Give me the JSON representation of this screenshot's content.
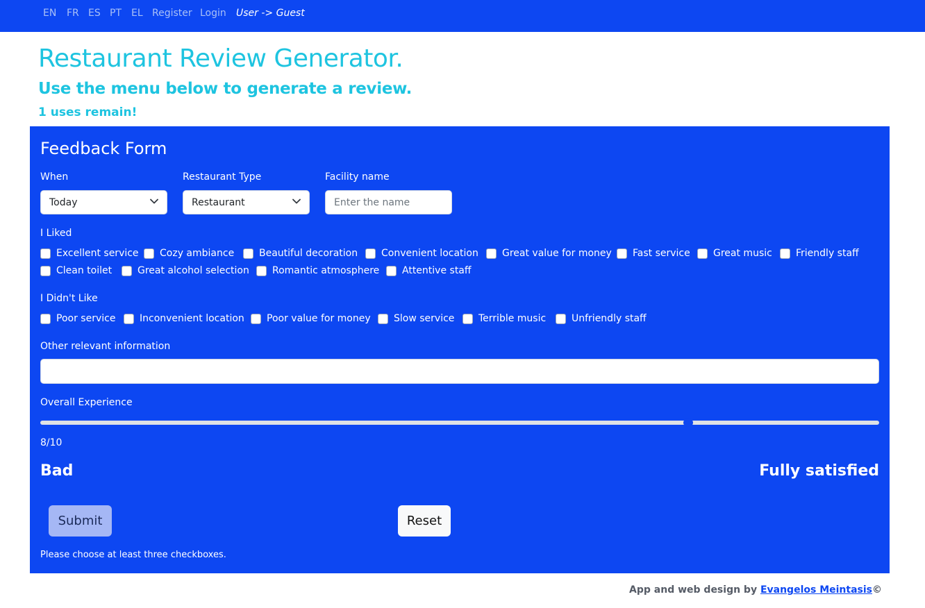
{
  "nav": {
    "items": [
      "EN",
      "FR",
      "ES",
      "PT",
      "EL",
      "Register",
      "Login"
    ],
    "user": "User -> Guest"
  },
  "header": {
    "title": "Restaurant Review Generator.",
    "subtitle": "Use the menu below to generate a review.",
    "uses": "1 uses remain!"
  },
  "form": {
    "title": "Feedback Form",
    "when": {
      "label": "When",
      "value": "Today"
    },
    "type": {
      "label": "Restaurant Type",
      "value": "Restaurant"
    },
    "facility": {
      "label": "Facility name",
      "placeholder": "Enter the name"
    },
    "liked": {
      "label": "I Liked",
      "items": [
        "Excellent service",
        "Cozy ambiance",
        "Beautiful decoration",
        "Convenient location",
        "Great value for money",
        "Fast service",
        "Great music",
        "Friendly staff",
        "Clean toilet",
        "Great alcohol selection",
        "Romantic atmosphere",
        "Attentive staff"
      ]
    },
    "disliked": {
      "label": "I Didn't Like",
      "items": [
        "Poor service",
        "Inconvenient location",
        "Poor value for money",
        "Slow service",
        "Terrible music",
        "Unfriendly staff"
      ]
    },
    "other": {
      "label": "Other relevant information"
    },
    "experience": {
      "label": "Overall Experience",
      "value": 8,
      "max": 10,
      "display": "8/10",
      "low_label": "Bad",
      "high_label": "Fully satisfied"
    },
    "submit_label": "Submit",
    "reset_label": "Reset",
    "hint": "Please choose at least three checkboxes."
  },
  "footer": {
    "text": "App and web design by ",
    "author": "Evangelos Meintasis",
    "suffix": "©"
  },
  "colors": {
    "primary": "#0d47f2",
    "accent": "#1ec4e0"
  }
}
